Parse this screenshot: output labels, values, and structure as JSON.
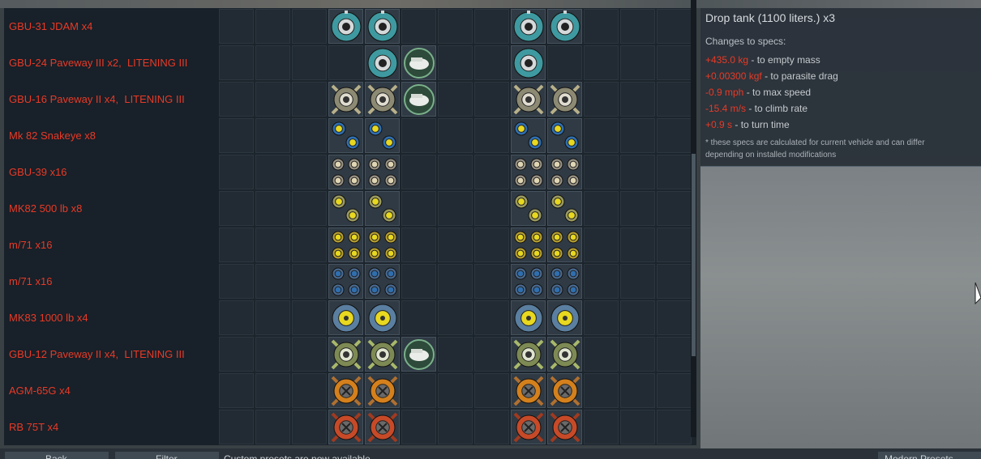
{
  "colors": {
    "label_red": "#e83a26",
    "panel_bg": "#1c242c",
    "cell_bg": "#222b33",
    "teal": "#3e9aa0",
    "gold": "#b8b08a",
    "yellow": "#e8d820",
    "blue": "#2f6fb0",
    "orange": "#d4801c",
    "red_orange": "#c74a28"
  },
  "rows": [
    {
      "label": "GBU-31 JDAM x4",
      "icon": "jdam-icon"
    },
    {
      "label": "GBU-24 Paveway III x2,  LITENING III",
      "icon": "paveway-iii-icon"
    },
    {
      "label": "GBU-16 Paveway II x4,  LITENING III",
      "icon": "paveway-ii-icon"
    },
    {
      "label": "Mk 82 Snakeye x8",
      "icon": "snakeye-bomb-icon"
    },
    {
      "label": "GBU-39 x16",
      "icon": "sdb-bomb-icon"
    },
    {
      "label": "MK82 500 lb x8",
      "icon": "mk82-bomb-icon"
    },
    {
      "label": "m/71 x16",
      "icon": "m71-yellow-bomb-icon"
    },
    {
      "label": "m/71 x16",
      "icon": "m71-blue-bomb-icon"
    },
    {
      "label": "MK83 1000 lb x4",
      "icon": "mk83-bomb-icon"
    },
    {
      "label": "GBU-12 Paveway II x4,  LITENING III",
      "icon": "gbu12-icon"
    },
    {
      "label": "AGM-65G x4",
      "icon": "agm65-missile-icon"
    },
    {
      "label": "RB 75T x4",
      "icon": "rb75-missile-icon"
    }
  ],
  "info": {
    "title": "Drop tank (1100 liters.) x3",
    "heading": "Changes to specs:",
    "lines": [
      {
        "value": "+435.0 kg",
        "text": " - to empty mass"
      },
      {
        "value": "+0.00300 kgf",
        "text": " - to parasite drag"
      },
      {
        "value": "-0.9 mph",
        "text": " - to max speed"
      },
      {
        "value": "-15.4 m/s",
        "text": " - to climb rate"
      },
      {
        "value": "+0.9 s",
        "text": " - to turn time"
      }
    ],
    "note": "* these specs are calculated for current vehicle and can differ depending on installed modifications"
  },
  "bottom": {
    "back_label": "Back",
    "filter_label": "Filter",
    "status_text": "Custom presets are now available",
    "right_label": "Modern Presets"
  }
}
